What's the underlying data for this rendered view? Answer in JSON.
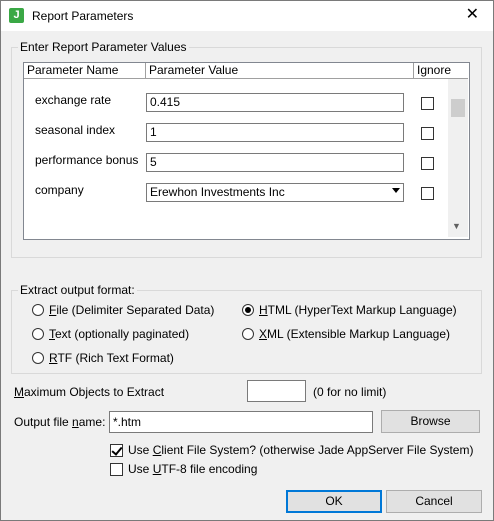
{
  "window": {
    "title": "Report Parameters",
    "app_icon_letter": "J",
    "close_glyph": "✕"
  },
  "param_group": {
    "label": "Enter Report Parameter Values",
    "columns": [
      "Parameter Name",
      "Parameter Value",
      "Ignore"
    ],
    "rows": [
      {
        "name": "exchange rate",
        "value": "0.415",
        "ignored": false
      },
      {
        "name": "seasonal index",
        "value": "1",
        "ignored": false
      },
      {
        "name": "performance bonus",
        "value": "5",
        "ignored": false
      },
      {
        "name": "company",
        "value": "Erewhon Investments Inc",
        "ignored": false
      }
    ]
  },
  "format_group": {
    "label": "Extract output format:",
    "options": {
      "file": {
        "hotkey": "F",
        "rest": "ile (Delimiter Separated Data)",
        "selected": false
      },
      "text": {
        "hotkey": "T",
        "rest": "ext (optionally paginated)",
        "selected": false
      },
      "rtf": {
        "hotkey": "R",
        "rest": "TF (Rich Text Format)",
        "selected": false
      },
      "html": {
        "hotkey": "H",
        "rest": "TML (HyperText Markup Language)",
        "selected": true
      },
      "xml": {
        "hotkey": "X",
        "rest": "ML (Extensible Markup Language)",
        "selected": false
      }
    }
  },
  "max_objects": {
    "hotkey": "M",
    "rest": "aximum Objects to Extract",
    "value": "",
    "hint": "(0 for no limit)"
  },
  "output_file": {
    "label_pre": "Output file ",
    "hotkey": "n",
    "label_post": "ame:",
    "value": "*.htm",
    "browse": "Browse"
  },
  "client_fs": {
    "pre": "Use ",
    "hotkey": "C",
    "post": "lient File System? (otherwise Jade AppServer File System)",
    "checked": true
  },
  "utf8": {
    "pre": "Use ",
    "hotkey": "U",
    "post": "TF-8 file encoding",
    "checked": false
  },
  "buttons": {
    "ok": "OK",
    "cancel": "Cancel"
  }
}
